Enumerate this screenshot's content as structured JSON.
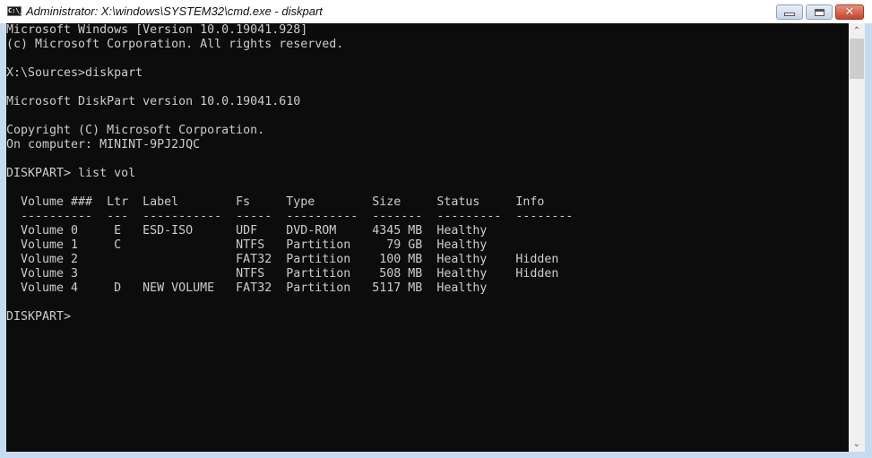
{
  "window": {
    "title": "Administrator: X:\\windows\\SYSTEM32\\cmd.exe - diskpart",
    "icon_label": "C:\\_",
    "controls": {
      "minimize": "minimize",
      "maximize": "maximize",
      "close": "✕"
    }
  },
  "console": {
    "lines": [
      "Microsoft Windows [Version 10.0.19041.928]",
      "(c) Microsoft Corporation. All rights reserved.",
      "",
      "X:\\Sources>diskpart",
      "",
      "Microsoft DiskPart version 10.0.19041.610",
      "",
      "Copyright (C) Microsoft Corporation.",
      "On computer: MININT-9PJ2JQC",
      "",
      "DISKPART> list vol",
      "",
      "  Volume ###  Ltr  Label        Fs     Type        Size     Status     Info",
      "  ----------  ---  -----------  -----  ----------  -------  ---------  --------",
      "  Volume 0     E   ESD-ISO      UDF    DVD-ROM     4345 MB  Healthy",
      "  Volume 1     C                NTFS   Partition     79 GB  Healthy",
      "  Volume 2                      FAT32  Partition    100 MB  Healthy    Hidden",
      "  Volume 3                      NTFS   Partition    508 MB  Healthy    Hidden",
      "  Volume 4     D   NEW VOLUME   FAT32  Partition   5117 MB  Healthy",
      "",
      "DISKPART> "
    ]
  },
  "scrollbar": {
    "up": "⌃",
    "down": "⌄"
  }
}
